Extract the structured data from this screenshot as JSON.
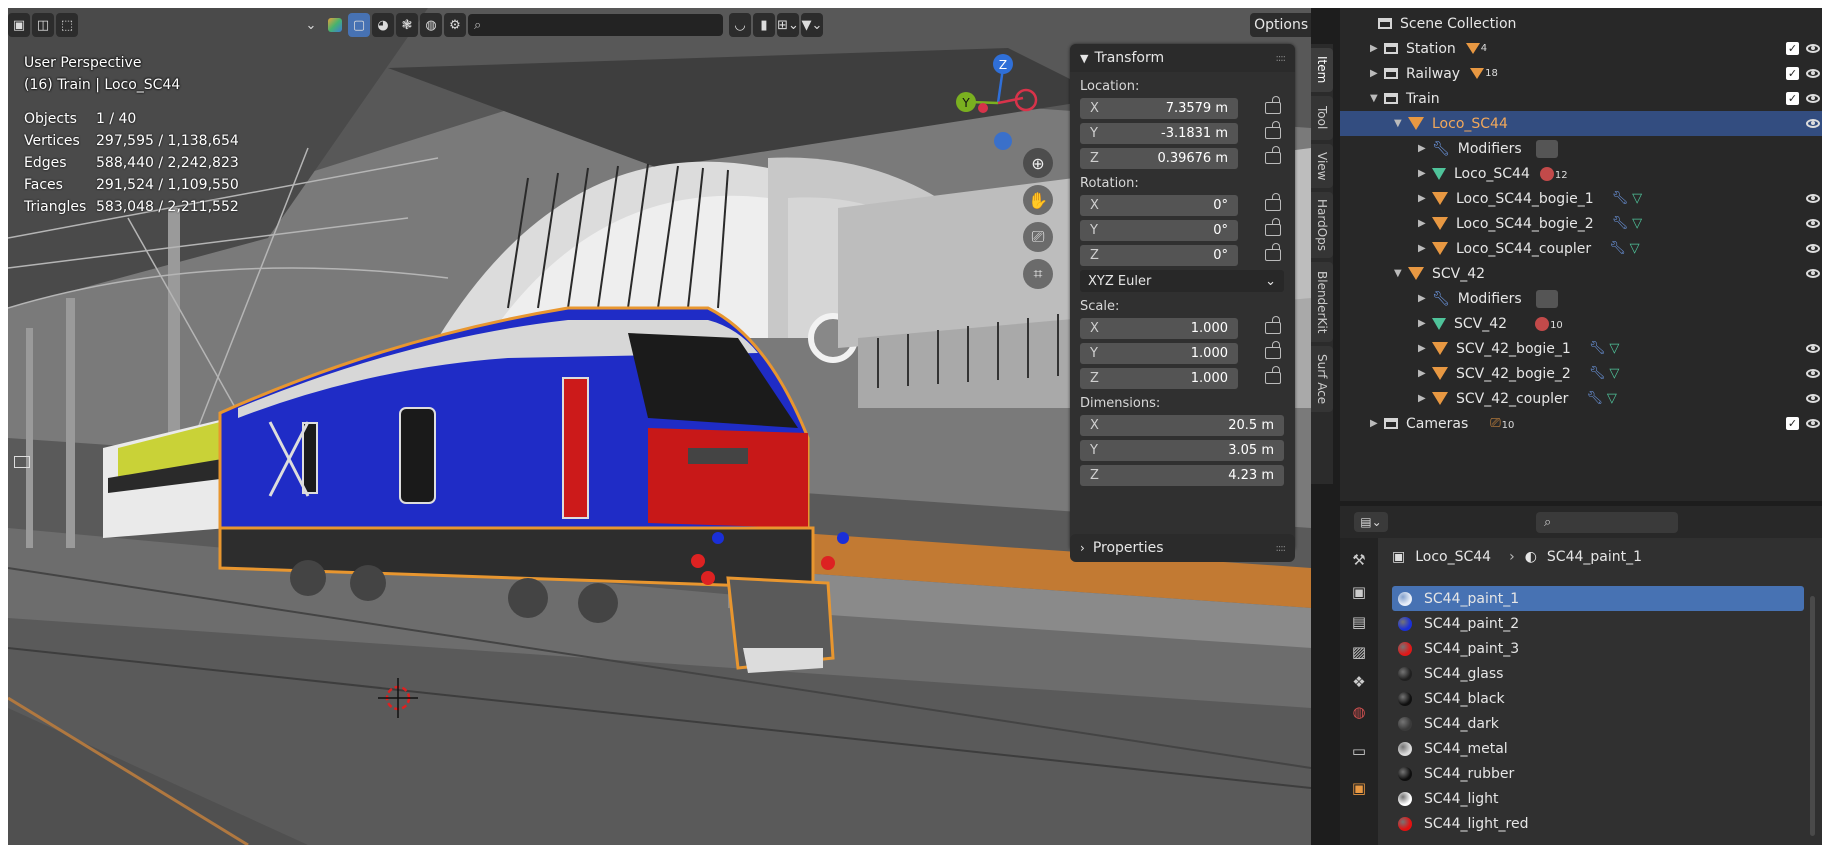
{
  "viewport": {
    "header": {
      "search_placeholder": "",
      "options_label": "Options"
    },
    "overlay": {
      "perspective": "User Perspective",
      "context": "(16) Train | Loco_SC44"
    },
    "stats": [
      {
        "label": "Objects",
        "value": "1 / 40"
      },
      {
        "label": "Vertices",
        "value": "297,595 / 1,138,654"
      },
      {
        "label": "Edges",
        "value": "588,440 / 2,242,823"
      },
      {
        "label": "Faces",
        "value": "291,524 / 1,109,550"
      },
      {
        "label": "Triangles",
        "value": "583,048 / 2,211,552"
      }
    ],
    "gizmo": {
      "z": "Z",
      "y": "Y"
    }
  },
  "npanel": {
    "title": "Transform",
    "location_label": "Location:",
    "location": [
      {
        "axis": "X",
        "value": "7.3579 m"
      },
      {
        "axis": "Y",
        "value": "-3.1831 m"
      },
      {
        "axis": "Z",
        "value": "0.39676 m"
      }
    ],
    "rotation_label": "Rotation:",
    "rotation": [
      {
        "axis": "X",
        "value": "0°"
      },
      {
        "axis": "Y",
        "value": "0°"
      },
      {
        "axis": "Z",
        "value": "0°"
      }
    ],
    "rotation_mode": "XYZ Euler",
    "scale_label": "Scale:",
    "scale": [
      {
        "axis": "X",
        "value": "1.000"
      },
      {
        "axis": "Y",
        "value": "1.000"
      },
      {
        "axis": "Z",
        "value": "1.000"
      }
    ],
    "dimensions_label": "Dimensions:",
    "dimensions": [
      {
        "axis": "X",
        "value": "20.5 m"
      },
      {
        "axis": "Y",
        "value": "3.05 m"
      },
      {
        "axis": "Z",
        "value": "4.23 m"
      }
    ],
    "properties_title": "Properties",
    "tabs": [
      "Item",
      "Tool",
      "View",
      "HardOps",
      "BlenderKit",
      "Surf Ace"
    ]
  },
  "outliner": {
    "rows": [
      {
        "label": "Scene Collection"
      },
      {
        "label": "Station",
        "badge": "4"
      },
      {
        "label": "Railway",
        "badge": "18"
      },
      {
        "label": "Train"
      },
      {
        "label": "Loco_SC44"
      },
      {
        "label": "Modifiers"
      },
      {
        "label": "Loco_SC44",
        "badge": "12"
      },
      {
        "label": "Loco_SC44_bogie_1"
      },
      {
        "label": "Loco_SC44_bogie_2"
      },
      {
        "label": "Loco_SC44_coupler"
      },
      {
        "label": "SCV_42"
      },
      {
        "label": "Modifiers"
      },
      {
        "label": "SCV_42",
        "badge": "10"
      },
      {
        "label": "SCV_42_bogie_1"
      },
      {
        "label": "SCV_42_bogie_2"
      },
      {
        "label": "SCV_42_coupler"
      },
      {
        "label": "Cameras",
        "badge": "10"
      }
    ]
  },
  "properties": {
    "breadcrumb_object": "Loco_SC44",
    "breadcrumb_material": "SC44_paint_1",
    "materials": [
      {
        "name": "SC44_paint_1",
        "color": "#e8eef8"
      },
      {
        "name": "SC44_paint_2",
        "color": "#1a2fd8"
      },
      {
        "name": "SC44_paint_3",
        "color": "#e01818"
      },
      {
        "name": "SC44_glass",
        "color": "#202020"
      },
      {
        "name": "SC44_black",
        "color": "#101010"
      },
      {
        "name": "SC44_dark",
        "color": "#3a3a3a"
      },
      {
        "name": "SC44_metal",
        "color": "#dcdcdc"
      },
      {
        "name": "SC44_rubber",
        "color": "#0e0e0e"
      },
      {
        "name": "SC44_light",
        "color": "#ffffff"
      },
      {
        "name": "SC44_light_red",
        "color": "#e41010"
      }
    ]
  }
}
